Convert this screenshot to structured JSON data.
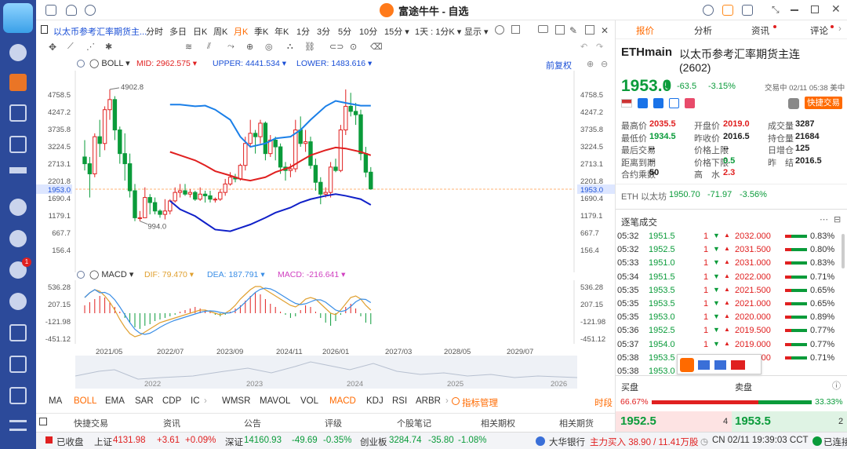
{
  "window": {
    "title": "富途牛牛 - 自选"
  },
  "toolbar": {
    "symbol": "以太币参考汇率期货主...",
    "items": [
      "分时",
      "多日",
      "日K",
      "周K",
      "月K",
      "季K",
      "年K",
      "1分",
      "3分",
      "5分",
      "10分",
      "15分 ▾",
      "1天 : 1分K ▾",
      "显示 ▾"
    ],
    "active": "月K"
  },
  "main_indicator": {
    "name": "BOLL",
    "mid_label": "MID:",
    "mid": "2962.575",
    "upper_label": "UPPER:",
    "upper": "4441.534",
    "lower_label": "LOWER:",
    "lower": "1483.616",
    "adjust": "前复权"
  },
  "price_axis": [
    "4758.5",
    "4247.2",
    "3735.8",
    "3224.5",
    "2713.1",
    "2201.8",
    "1953.0",
    "1690.4",
    "1179.1",
    "667.7",
    "156.4"
  ],
  "annotations": {
    "high": "4902.8",
    "low": "994.0"
  },
  "macd": {
    "name": "MACD",
    "dif_label": "DIF:",
    "dif": "79.470",
    "dea_label": "DEA:",
    "dea": "187.791",
    "macd_label": "MACD:",
    "macd": "-216.641",
    "axis": [
      "536.28",
      "207.15",
      "-121.98",
      "-451.12"
    ]
  },
  "x_axis": [
    "2021/05",
    "2022/07",
    "2023/09",
    "2024/11",
    "2026/01",
    "2027/03",
    "2028/05",
    "2029/07"
  ],
  "timeline_years": [
    "2022",
    "2023",
    "2024",
    "2025",
    "2026"
  ],
  "indicators": [
    "MA",
    "BOLL",
    "EMA",
    "SAR",
    "CDP",
    "IC",
    "WMSR",
    "MAVOL",
    "VOL",
    "MACD",
    "KDJ",
    "RSI",
    "ARBR"
  ],
  "indicator_manage": "指标管理",
  "indicator_right": "时段",
  "bottom_tabs": [
    "快捷交易",
    "资讯",
    "公告",
    "评级",
    "个股笔记",
    "相关期权",
    "相关期货"
  ],
  "status": {
    "closed": "已收盘",
    "sh_label": "上证",
    "sh": "4131.98",
    "sh_chg": "+3.61",
    "sh_pct": "+0.09%",
    "sz_label": "深证",
    "sz": "14160.93",
    "sz_chg": "-49.69",
    "sz_pct": "-0.35%",
    "cy_label": "创业板",
    "cy": "3284.74",
    "cy_chg": "-35.80",
    "cy_pct": "-1.08%",
    "bank": "大华银行",
    "bank_info": "主力买入 38.90 / 11.41万股",
    "time": "CN 02/11 19:39:03 CCT",
    "conn": "已连接"
  },
  "right": {
    "tabs": [
      "报价",
      "分析",
      "资讯",
      "评论"
    ],
    "code": "ETHmain",
    "name": "以太币参考汇率期货主连",
    "suffix": "(2602)",
    "price": "1953.0",
    "arrow": "⬇",
    "change": "-63.5",
    "pct": "-3.15%",
    "time": "交易中 02/11 05:38 美中",
    "trade_btn": "快捷交易",
    "quotes": [
      [
        "最高价",
        "2035.5",
        "开盘价",
        "2019.0",
        "成交量",
        "3287"
      ],
      [
        "最低价",
        "1934.5",
        "昨收价",
        "2016.5",
        "持仓量",
        "21684"
      ],
      [
        "最后交易",
        "--",
        "价格上限",
        "--",
        "日增仓",
        "125"
      ],
      [
        "距离到期",
        "--",
        "价格下限",
        "0.5",
        "昨　结",
        "2016.5"
      ],
      [
        "合约乘数",
        "50",
        "高　水",
        "2.3",
        "",
        ""
      ]
    ],
    "eth_label": "ETH 以太坊",
    "eth_price": "1950.70",
    "eth_chg": "-71.97",
    "eth_pct": "-3.56%",
    "ticks_title": "逐笔成交",
    "ticks": [
      [
        "05:32",
        "1951.5",
        "1",
        "2032.000",
        "0.83%"
      ],
      [
        "05:32",
        "1952.5",
        "1",
        "2031.500",
        "0.80%"
      ],
      [
        "05:33",
        "1951.0",
        "1",
        "2031.000",
        "0.83%"
      ],
      [
        "05:34",
        "1951.5",
        "1",
        "2022.000",
        "0.71%"
      ],
      [
        "05:35",
        "1953.5",
        "1",
        "2021.500",
        "0.65%"
      ],
      [
        "05:35",
        "1953.5",
        "1",
        "2021.000",
        "0.65%"
      ],
      [
        "05:35",
        "1953.0",
        "1",
        "2020.000",
        "0.89%"
      ],
      [
        "05:36",
        "1952.5",
        "1",
        "2019.500",
        "0.77%"
      ],
      [
        "05:37",
        "1954.0",
        "1",
        "2019.000",
        "0.77%"
      ],
      [
        "05:38",
        "1953.5",
        "1",
        "1990.000",
        "0.71%"
      ],
      [
        "05:38",
        "1953.0",
        "1",
        "",
        ""
      ]
    ],
    "buy_label": "买盘",
    "sell_label": "卖盘",
    "buy_pct": "66.67%",
    "sell_pct": "33.33%",
    "bid": "1952.5",
    "bid_qty": "4",
    "ask": "1953.5",
    "ask_qty": "2"
  },
  "colors": {
    "up": "#e02020",
    "down": "#0a9b3a",
    "accent": "#ff6a00",
    "link": "#1a4fd6"
  }
}
